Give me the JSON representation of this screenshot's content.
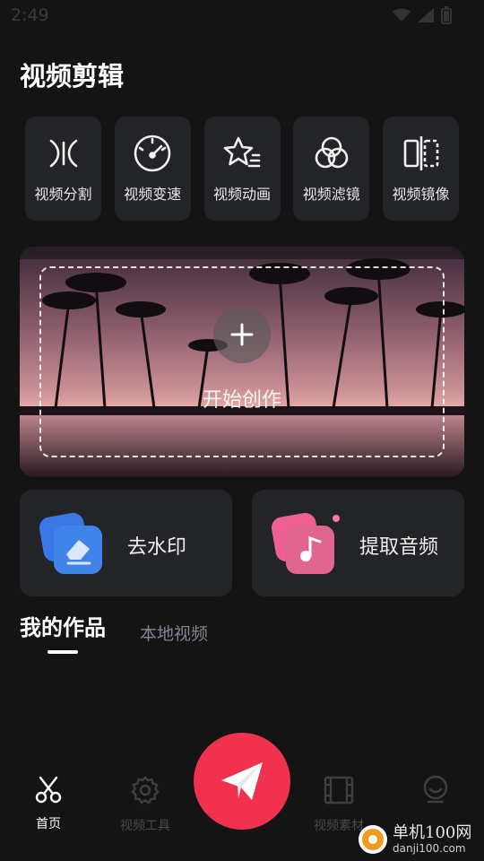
{
  "status_bar": {
    "time": "2:49"
  },
  "header": {
    "title": "视频剪辑"
  },
  "tools": [
    {
      "label": "视频分割",
      "icon": "split-icon"
    },
    {
      "label": "视频变速",
      "icon": "speedometer-icon"
    },
    {
      "label": "视频动画",
      "icon": "star-animation-icon"
    },
    {
      "label": "视频滤镜",
      "icon": "filter-circles-icon"
    },
    {
      "label": "视频镜像",
      "icon": "mirror-icon"
    }
  ],
  "banner": {
    "label": "开始创作",
    "icon": "plus-icon"
  },
  "actions": {
    "watermark": {
      "label": "去水印",
      "icon": "eraser-icon",
      "color": "#3b7ff0"
    },
    "audio": {
      "label": "提取音频",
      "icon": "music-note-icon",
      "color": "#f0648c"
    }
  },
  "tabs": {
    "active": "我的作品",
    "inactive": "本地视频"
  },
  "bottom_nav": {
    "home": "首页",
    "tools": "视频工具",
    "material": "视频素材",
    "profile": ""
  },
  "fab": {
    "icon": "paper-plane-icon",
    "color": "#f0324f"
  },
  "watermark_logo": {
    "title": "单机100网",
    "url": "danji100.com"
  }
}
